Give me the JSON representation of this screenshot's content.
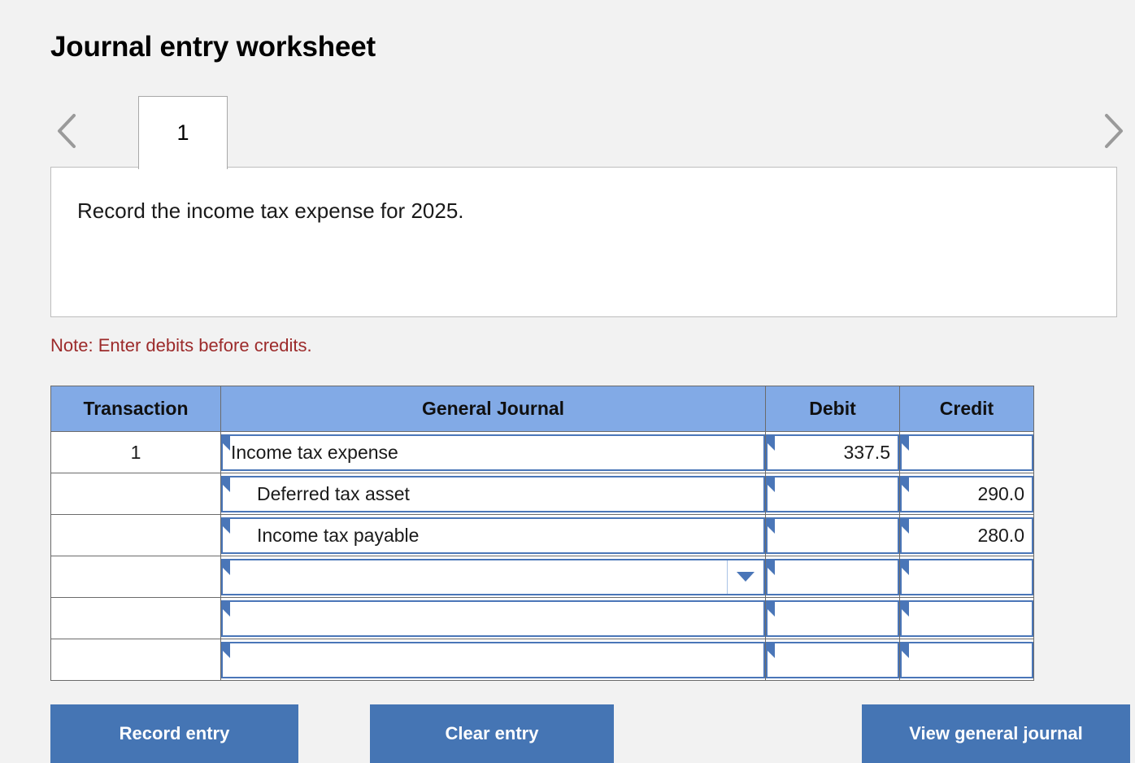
{
  "page": {
    "title": "Journal entry worksheet",
    "background_color": "#f2f2f2"
  },
  "tabs": {
    "prev_icon": "chevron-left-icon",
    "next_icon": "chevron-right-icon",
    "items": [
      {
        "label": "1",
        "selected": true
      }
    ]
  },
  "instruction_panel": {
    "text": "Record the income tax expense for 2025."
  },
  "note": {
    "text": "Note: Enter debits before credits.",
    "color": "#9c2a2a"
  },
  "journal_table": {
    "header_color": "#82aae6",
    "columns": [
      {
        "key": "transaction",
        "label": "Transaction"
      },
      {
        "key": "general_journal",
        "label": "General Journal"
      },
      {
        "key": "debit",
        "label": "Debit"
      },
      {
        "key": "credit",
        "label": "Credit"
      }
    ],
    "rows": [
      {
        "transaction": "1",
        "account": "Income tax expense",
        "indented": false,
        "debit": "337.5",
        "credit": "",
        "has_dropdown": false
      },
      {
        "transaction": "",
        "account": "Deferred tax asset",
        "indented": true,
        "debit": "",
        "credit": "290.0",
        "has_dropdown": false
      },
      {
        "transaction": "",
        "account": "Income tax payable",
        "indented": true,
        "debit": "",
        "credit": "280.0",
        "has_dropdown": false
      },
      {
        "transaction": "",
        "account": "",
        "indented": false,
        "debit": "",
        "credit": "",
        "has_dropdown": true
      },
      {
        "transaction": "",
        "account": "",
        "indented": false,
        "debit": "",
        "credit": "",
        "has_dropdown": false
      },
      {
        "transaction": "",
        "account": "",
        "indented": false,
        "debit": "",
        "credit": "",
        "has_dropdown": false
      }
    ]
  },
  "buttons": {
    "record_entry": "Record entry",
    "clear_entry": "Clear entry",
    "view_general_journal": "View general journal",
    "color": "#4575b4"
  }
}
